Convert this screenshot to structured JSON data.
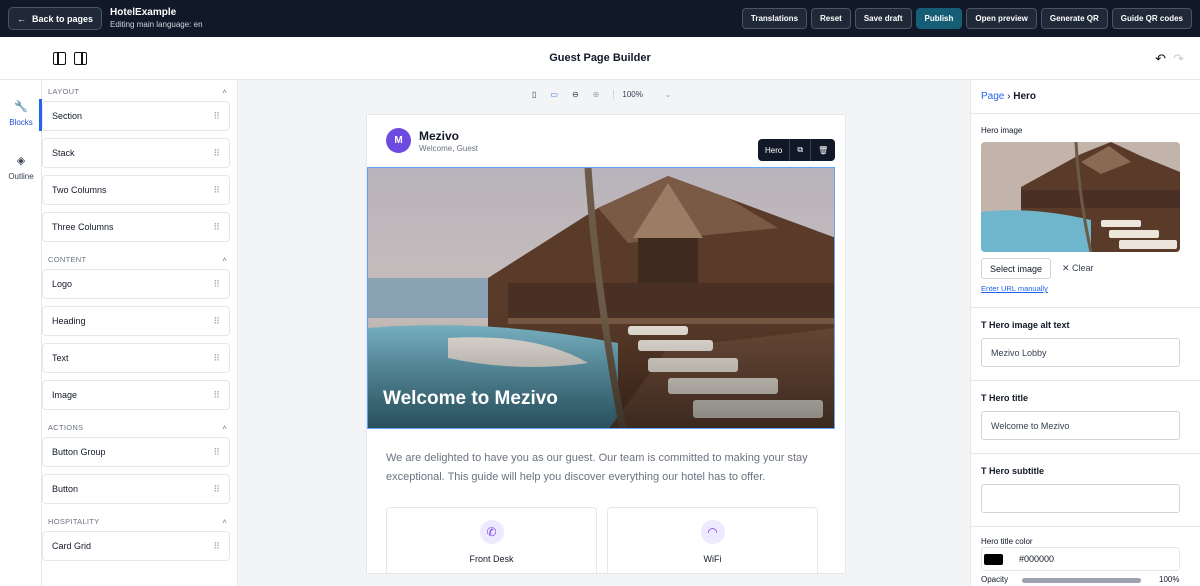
{
  "topbar": {
    "back_label": "Back to pages",
    "project_name": "HotelExample",
    "project_sub": "Editing main language: en",
    "actions": [
      "Translations",
      "Reset",
      "Save draft",
      "Publish",
      "Open preview",
      "Generate QR",
      "Guide QR codes"
    ]
  },
  "header": {
    "title": "Guest Page Builder"
  },
  "rail": {
    "blocks_label": "Blocks",
    "outline_label": "Outline"
  },
  "blocks": {
    "layout": {
      "title": "LAYOUT",
      "items": [
        "Section",
        "Stack",
        "Two Columns",
        "Three Columns"
      ]
    },
    "content": {
      "title": "CONTENT",
      "items": [
        "Logo",
        "Heading",
        "Text",
        "Image"
      ]
    },
    "actions": {
      "title": "ACTIONS",
      "items": [
        "Button Group",
        "Button"
      ]
    },
    "hospitality": {
      "title": "HOSPITALITY",
      "items": [
        "Card Grid"
      ]
    }
  },
  "canvas": {
    "zoom": "100%",
    "brand_initial": "M",
    "brand_name": "Mezivo",
    "brand_sub": "Welcome, Guest",
    "hero_toolbar_label": "Hero",
    "hero_title": "Welcome to Mezivo",
    "intro": "We are delighted to have you as our guest. Our team is committed to making your stay exceptional. This guide will help you discover everything our hotel has to offer.",
    "cards": [
      {
        "label": "Front Desk",
        "icon": "phone-icon"
      },
      {
        "label": "WiFi",
        "icon": "wifi-icon"
      }
    ]
  },
  "inspector": {
    "crumb_page": "Page",
    "crumb_current": "Hero",
    "hero_image_label": "Hero image",
    "select_image": "Select image",
    "clear": "Clear",
    "enter_url": "Enter URL manually",
    "alt_label": "Hero image alt text",
    "alt_value": "Mezivo Lobby",
    "title_label": "Hero title",
    "title_value": "Welcome to Mezivo",
    "subtitle_label": "Hero subtitle",
    "subtitle_value": "",
    "title_color_label": "Hero title color",
    "title_color_value": "#000000",
    "opacity_label": "Opacity",
    "opacity_value": "100%",
    "opacity_fraction": 1.0
  },
  "colors": {
    "accent": "#2563eb",
    "topbar": "#111827",
    "publish": "#155e75",
    "brand": "#6d4ae0"
  }
}
